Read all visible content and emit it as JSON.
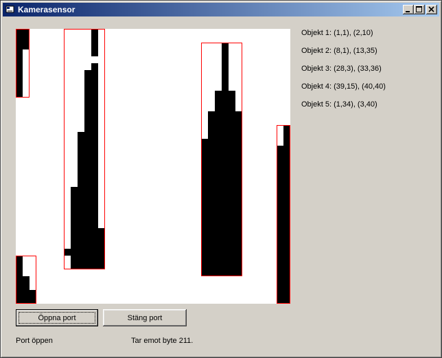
{
  "window": {
    "title": "Kamerasensor"
  },
  "objects": [
    {
      "label": "Objekt 1: (1,1), (2,10)"
    },
    {
      "label": "Objekt 2: (8,1), (13,35)"
    },
    {
      "label": "Objekt 3: (28,3), (33,36)"
    },
    {
      "label": "Objekt 4: (39,15), (40,40)"
    },
    {
      "label": "Objekt 5: (1,34), (3,40)"
    }
  ],
  "buttons": {
    "open_port": "Öppna port",
    "close_port": "Stäng port"
  },
  "status": {
    "port": "Port öppen",
    "receive": "Tar emot byte 211."
  },
  "colors": {
    "box": "#ff0000",
    "pixel_on": "#000000",
    "pixel_off": "#ffffff",
    "title_start": "#0a246a",
    "title_end": "#a6caf0"
  },
  "icons": {
    "app": "app-icon",
    "minimize": "minimize-icon",
    "maximize": "maximize-icon",
    "close": "close-icon"
  }
}
